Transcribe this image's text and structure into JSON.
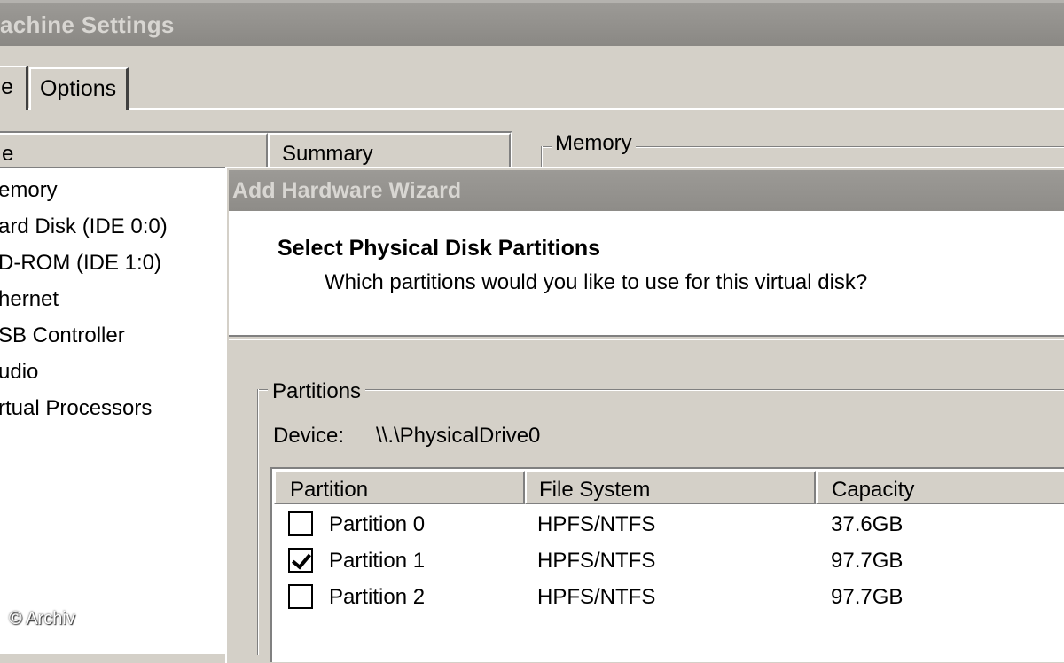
{
  "background_window": {
    "title": "achine Settings",
    "tabs": [
      {
        "label": "e",
        "active": true
      },
      {
        "label": "Options",
        "active": false
      }
    ],
    "device_list": {
      "headers": {
        "device": "e",
        "summary": "Summary"
      },
      "items": [
        {
          "label": "emory",
          "selected": true
        },
        {
          "label": "ard Disk (IDE 0:0)"
        },
        {
          "label": "D-ROM (IDE 1:0)"
        },
        {
          "label": "hernet"
        },
        {
          "label": "SB Controller"
        },
        {
          "label": "udio"
        },
        {
          "label": "rtual Processors"
        }
      ]
    },
    "memory_group_label": "Memory"
  },
  "wizard": {
    "title": "Add Hardware Wizard",
    "heading": "Select Physical Disk Partitions",
    "subheading": "Which partitions would you like to use for this virtual disk?",
    "partitions_group_label": "Partitions",
    "device_label": "Device:",
    "device_value": "\\\\.\\PhysicalDrive0",
    "columns": {
      "partition": "Partition",
      "file_system": "File System",
      "capacity": "Capacity"
    },
    "rows": [
      {
        "name": "Partition 0",
        "file_system": "HPFS/NTFS",
        "capacity": "37.6GB",
        "checked": false
      },
      {
        "name": "Partition 1",
        "file_system": "HPFS/NTFS",
        "capacity": "97.7GB",
        "checked": true
      },
      {
        "name": "Partition 2",
        "file_system": "HPFS/NTFS",
        "capacity": "97.7GB",
        "checked": false
      }
    ]
  },
  "watermark": "© Archiv",
  "colors": {
    "window_bg": "#d4d0c8",
    "titlebar_inactive": "#8e8c88",
    "list_bg": "#ffffff"
  }
}
